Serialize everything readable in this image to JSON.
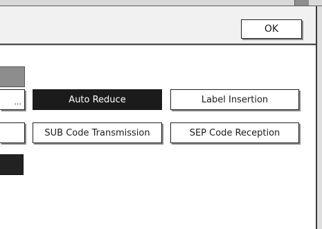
{
  "header": {
    "ok_label": "OK"
  },
  "side": {
    "ellipsis_label": "..."
  },
  "buttons": {
    "auto_reduce": "Auto Reduce",
    "label_insertion": "Label Insertion",
    "sub_code_transmission": "SUB Code Transmission",
    "sep_code_reception": "SEP Code Reception"
  },
  "state": {
    "selected": "Auto Reduce"
  },
  "colors": {
    "selected_background": "#1b1b1b",
    "button_background": "#ffffff",
    "header_background": "#f1f1f1"
  }
}
